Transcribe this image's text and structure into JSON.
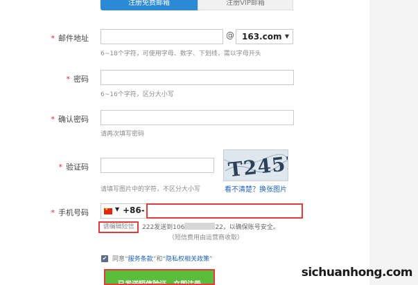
{
  "tabs": {
    "free": "注册免费邮箱",
    "vip": "注册VIP邮箱"
  },
  "required_mark": "*",
  "email": {
    "label": "邮件地址",
    "at": "@",
    "domain": "163.com",
    "hint": "6~18个字符，可使用字母、数字、下划线，需以字母开头"
  },
  "password": {
    "label": "密码",
    "hint": "6~16个字符，区分大小写"
  },
  "confirm": {
    "label": "确认密码",
    "hint": "请再次填写密码"
  },
  "captcha": {
    "label": "验证码",
    "hint": "请填写图片中的字符，不区分大小写",
    "image_text": "T2452",
    "refresh_link": "看不清楚？换张图片"
  },
  "phone": {
    "label": "手机号码",
    "prefix": "+86-",
    "flag": "china-flag-icon"
  },
  "sms": {
    "edit": "请编辑短信",
    "send_before": "222发送到106",
    "send_after": "22，以确保账号安全。",
    "note": "（短信费用由运营商收取）"
  },
  "agreement": {
    "prefix": "同意“",
    "terms": "服务条款",
    "middle": "”和“",
    "privacy": "隐私权相关政策",
    "suffix": "”"
  },
  "submit": {
    "label": "已发送短信验证，立即注册"
  },
  "watermark": "sichuanhong.com",
  "colors": {
    "accent": "#2b89d6",
    "submit": "#5bbd3c",
    "highlight": "#e23b3b",
    "link": "#1e63b8"
  }
}
